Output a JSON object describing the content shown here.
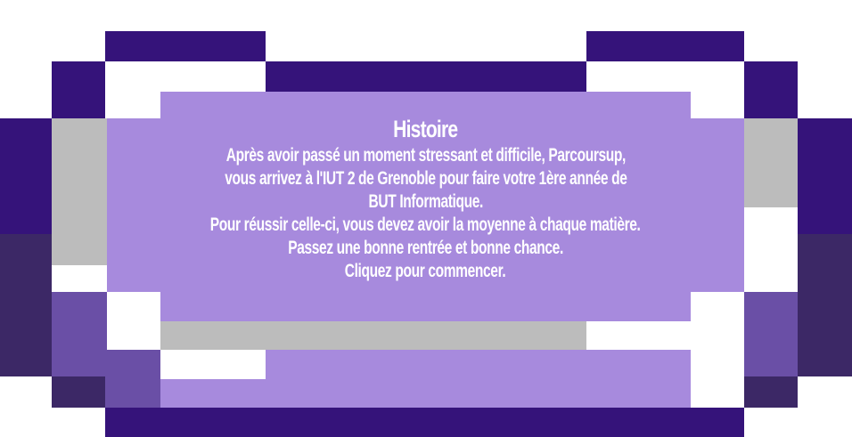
{
  "story": {
    "title": "Histoire",
    "lines": [
      "Après avoir passé un moment stressant et difficile, Parcoursup,",
      "vous arrivez à l'IUT 2 de Grenoble pour faire votre 1ère année de",
      "BUT Informatique.",
      "Pour réussir celle-ci, vous devez avoir la moyenne à chaque matière.",
      "Passez une bonne rentrée et bonne chance.",
      "Cliquez pour commencer."
    ]
  },
  "palette": {
    "dark_purple": "#35137a",
    "deep_purple": "#3c2866",
    "violet": "#6a4fa6",
    "lavender": "#a78add",
    "grey": "#bcbcbc",
    "text": "#ffffff"
  }
}
